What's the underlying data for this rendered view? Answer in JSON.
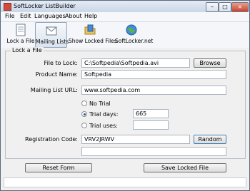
{
  "window": {
    "title": "SoftLocker ListBuilder",
    "minimize": "–",
    "maximize": "□",
    "close": "×"
  },
  "menu": [
    "File",
    "Edit",
    "Languages",
    "About",
    "Help"
  ],
  "toolbar": [
    "Lock a File",
    "Mailing Lists",
    "Show Locked Files",
    "SoftLocker.net"
  ],
  "group": {
    "title": "Lock a File"
  },
  "form": {
    "file_label": "File to Lock:",
    "file_value": "C:\\Softpedia\\Softpedia.avi",
    "browse": "Browse",
    "product_label": "Product Name:",
    "product_value": "Softpedia",
    "url_label": "Mailing List URL:",
    "url_value": "www.softpedia.com",
    "no_trial": "No Trial",
    "trial_days": "Trial days:",
    "trial_days_value": "665",
    "trial_uses": "Trial uses:",
    "trial_uses_value": "",
    "reg_label": "Registration Code:",
    "reg_value": "VRV2JRWV",
    "random": "Random",
    "extra_value": ""
  },
  "buttons": {
    "reset": "Reset Form",
    "save": "Save Locked File"
  },
  "colors": {
    "titlebar": "#c9d7e8",
    "close": "#c8422c",
    "radio_selected": "#2c4f8c"
  }
}
